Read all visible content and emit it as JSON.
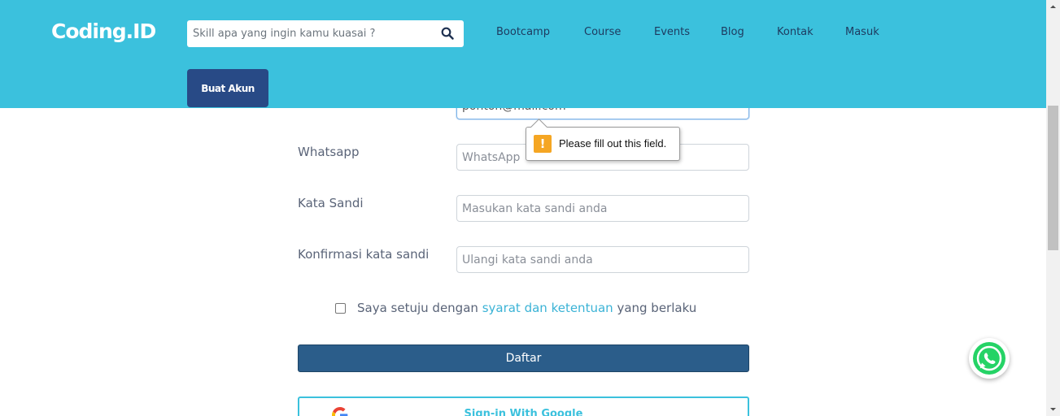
{
  "header": {
    "logo": "Coding.ID",
    "search": {
      "placeholder": "Skill apa yang ingin kamu kuasai ?",
      "icon": "search-icon"
    },
    "nav": [
      "Bootcamp",
      "Course",
      "Events",
      "Blog",
      "Kontak",
      "Masuk"
    ],
    "cta": "Buat Akun",
    "background_color": "#3bc1dd"
  },
  "form": {
    "email_partial_value": "pontoh@mail.com",
    "whatsapp": {
      "label": "Whatsapp",
      "placeholder": "WhatsApp"
    },
    "password": {
      "label": "Kata Sandi",
      "placeholder": "Masukan kata sandi anda"
    },
    "confirm_password": {
      "label": "Konfirmasi kata sandi",
      "placeholder": "Ulangi kata sandi anda"
    },
    "agreement": {
      "prefix": "Saya setuju dengan",
      "link": "syarat dan ketentuan",
      "suffix": "yang berlaku",
      "checked": false
    },
    "submit": "Daftar",
    "google": "Sign-in With Google"
  },
  "validation_tooltip": {
    "message": "Please fill out this field.",
    "icon": "warning-icon"
  },
  "floating": {
    "whatsapp_icon": "whatsapp-icon"
  }
}
